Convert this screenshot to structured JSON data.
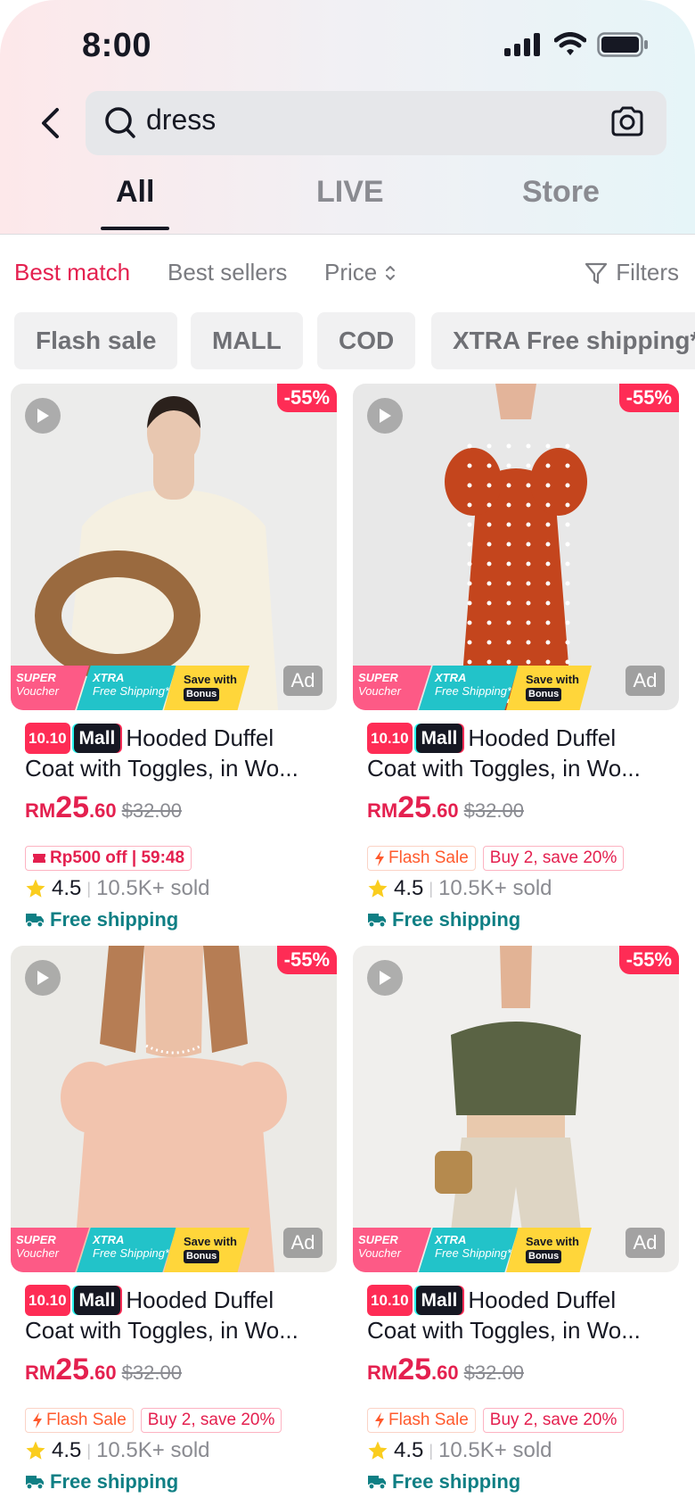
{
  "status": {
    "time": "8:00"
  },
  "search": {
    "query": "dress"
  },
  "tabs": [
    {
      "label": "All",
      "active": true
    },
    {
      "label": "LIVE",
      "active": false
    },
    {
      "label": "Store",
      "active": false
    }
  ],
  "sort": {
    "best_match": "Best match",
    "best_sellers": "Best sellers",
    "price": "Price",
    "filters": "Filters"
  },
  "chips": [
    "Flash sale",
    "MALL",
    "COD",
    "XTRA Free shipping*"
  ],
  "promo": {
    "super": "SUPER",
    "voucher": "Voucher",
    "xtra": "XTRA",
    "free_shipping": "Free Shipping*",
    "save_with": "Save with",
    "bonus": "Bonus"
  },
  "colors": {
    "accent": "#e4204f",
    "discount": "#fe2c55",
    "shipping": "#0f7f84"
  },
  "products": [
    {
      "discount": "-55%",
      "ad": "Ad",
      "label_1010": "10.10",
      "label_mall": "Mall",
      "title_line1": "Hooded Duffel",
      "title_line2": "Coat with Toggles, in Wo...",
      "currency": "RM",
      "price_int": "25",
      "price_dec": ".60",
      "old_price": "$32.00",
      "tag1": "Rp500 off | 59:48",
      "tag2": "",
      "rating": "4.5",
      "sold": "10.5K+ sold",
      "shipping": "Free shipping"
    },
    {
      "discount": "-55%",
      "ad": "Ad",
      "label_1010": "10.10",
      "label_mall": "Mall",
      "title_line1": "Hooded Duffel",
      "title_line2": "Coat with Toggles, in Wo...",
      "currency": "RM",
      "price_int": "25",
      "price_dec": ".60",
      "old_price": "$32.00",
      "tag1": "Flash Sale",
      "tag2": "Buy 2, save 20%",
      "rating": "4.5",
      "sold": "10.5K+ sold",
      "shipping": "Free shipping"
    },
    {
      "discount": "-55%",
      "ad": "Ad",
      "label_1010": "10.10",
      "label_mall": "Mall",
      "title_line1": "Hooded Duffel",
      "title_line2": "Coat with Toggles, in Wo...",
      "currency": "RM",
      "price_int": "25",
      "price_dec": ".60",
      "old_price": "$32.00",
      "tag1": "Flash Sale",
      "tag2": "Buy 2, save 20%",
      "rating": "4.5",
      "sold": "10.5K+ sold",
      "shipping": "Free shipping"
    },
    {
      "discount": "-55%",
      "ad": "Ad",
      "label_1010": "10.10",
      "label_mall": "Mall",
      "title_line1": "Hooded Duffel",
      "title_line2": "Coat with Toggles, in Wo...",
      "currency": "RM",
      "price_int": "25",
      "price_dec": ".60",
      "old_price": "$32.00",
      "tag1": "Flash Sale",
      "tag2": "Buy 2, save 20%",
      "rating": "4.5",
      "sold": "10.5K+ sold",
      "shipping": "Free shipping"
    }
  ]
}
